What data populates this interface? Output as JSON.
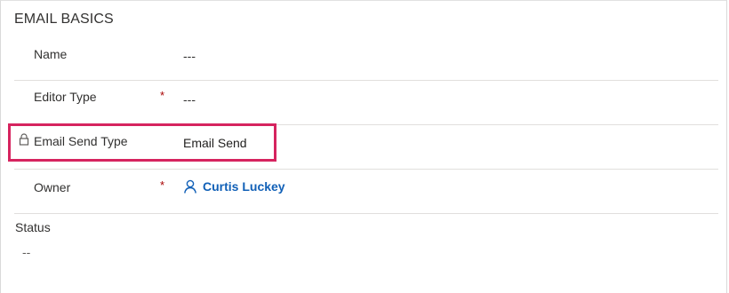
{
  "section": {
    "title": "EMAIL BASICS"
  },
  "fields": {
    "name": {
      "label": "Name",
      "value": "---"
    },
    "editor_type": {
      "label": "Editor Type",
      "required_mark": "*",
      "value": "---"
    },
    "email_send_type": {
      "label": "Email Send Type",
      "value": "Email Send",
      "locked": true,
      "icon": "lock-icon"
    },
    "owner": {
      "label": "Owner",
      "required_mark": "*",
      "value": "Curtis Luckey",
      "icon": "person-icon"
    }
  },
  "status": {
    "label": "Status",
    "value": "--"
  },
  "colors": {
    "highlight": "#d6245f",
    "link": "#1160b7",
    "required": "#a80000"
  }
}
